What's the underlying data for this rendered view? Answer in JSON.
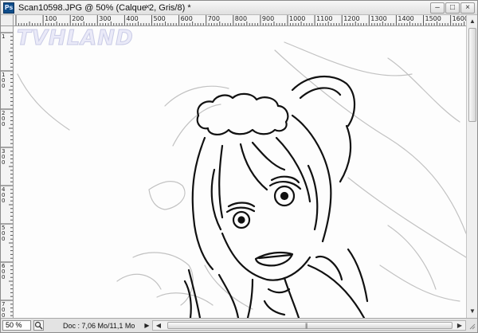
{
  "app": {
    "icon_label": "Ps",
    "document_title": "Scan10598.JPG @ 50% (Calque 2, Gris/8) *",
    "tab_close_glyph": "×"
  },
  "window_controls": {
    "minimize": "–",
    "maximize": "□",
    "close": "×"
  },
  "ruler": {
    "horizontal_labels": [
      "100",
      "200",
      "300",
      "400",
      "500",
      "600",
      "700",
      "800",
      "900",
      "1000",
      "1100",
      "1200",
      "1300",
      "1400",
      "1500",
      "1600"
    ],
    "vertical_labels": [
      "1",
      "100",
      "200",
      "300",
      "400",
      "500",
      "600",
      "700"
    ]
  },
  "canvas": {
    "watermark_text": "TVHLAND",
    "layer": "Calque 2",
    "mode": "Gris/8"
  },
  "statusbar": {
    "zoom": "50 %",
    "doc_info": "Doc : 7,06 Mo/11,1 Mo",
    "arrow_glyph": "▶",
    "scroll_left": "◀",
    "scroll_right": "▶",
    "grip": "|||"
  },
  "vscroll": {
    "up": "▲",
    "down": "▼"
  },
  "colors": {
    "ink": "#111111",
    "sketch": "#b9b9b9",
    "canvas": "#fdfdfd",
    "chrome": "#e3e3e3"
  }
}
